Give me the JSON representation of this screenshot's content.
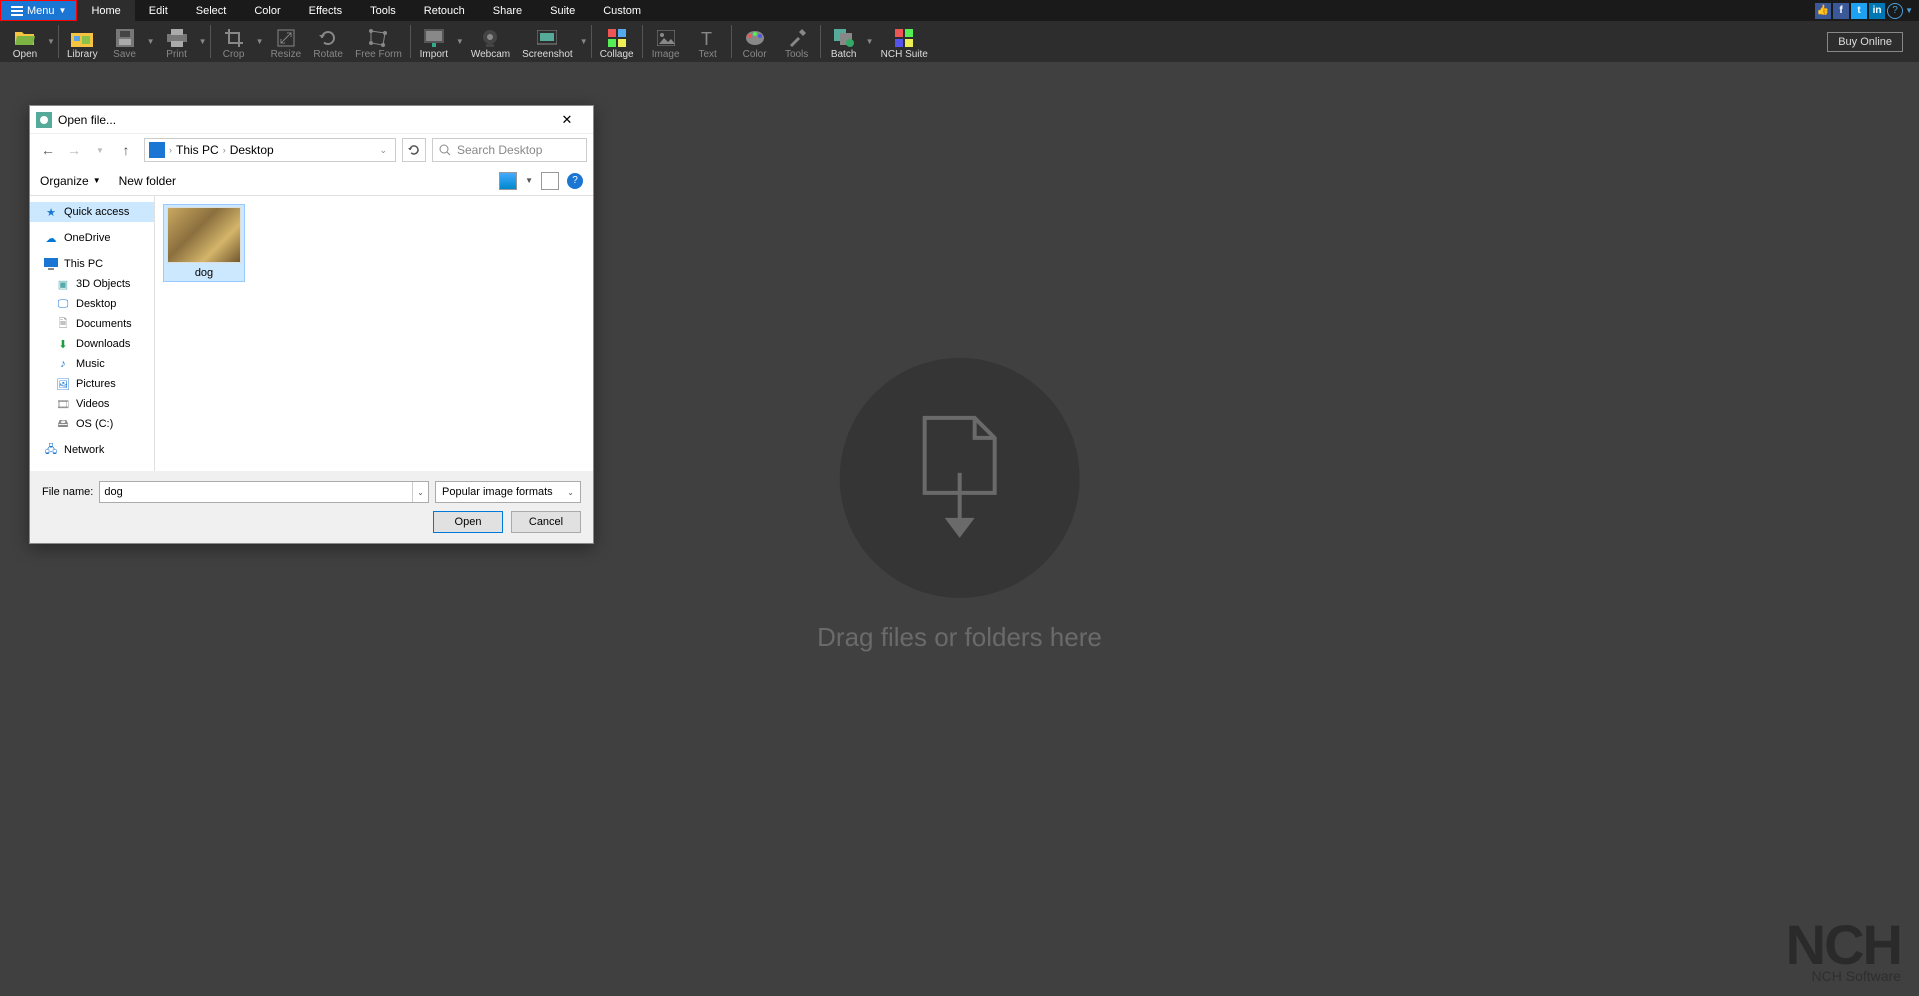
{
  "menu": {
    "button": "Menu",
    "tabs": [
      "Home",
      "Edit",
      "Select",
      "Color",
      "Effects",
      "Tools",
      "Retouch",
      "Share",
      "Suite",
      "Custom"
    ],
    "active": "Home"
  },
  "ribbon": {
    "open": "Open",
    "library": "Library",
    "save": "Save",
    "print": "Print",
    "crop": "Crop",
    "resize": "Resize",
    "rotate": "Rotate",
    "freeform": "Free Form",
    "import": "Import",
    "webcam": "Webcam",
    "screenshot": "Screenshot",
    "collage": "Collage",
    "image": "Image",
    "text": "Text",
    "color": "Color",
    "tools": "Tools",
    "batch": "Batch",
    "nchsuite": "NCH Suite",
    "buy": "Buy Online"
  },
  "canvas": {
    "drop_text": "Drag files or folders here"
  },
  "watermark": {
    "brand": "NCH",
    "sub": "NCH Software"
  },
  "dialog": {
    "title": "Open file...",
    "breadcrumb": {
      "root": "This PC",
      "folder": "Desktop"
    },
    "search_placeholder": "Search Desktop",
    "organize": "Organize",
    "newfolder": "New folder",
    "sidebar": {
      "quick": "Quick access",
      "onedrive": "OneDrive",
      "thispc": "This PC",
      "obj3d": "3D Objects",
      "desktop": "Desktop",
      "documents": "Documents",
      "downloads": "Downloads",
      "music": "Music",
      "pictures": "Pictures",
      "videos": "Videos",
      "osc": "OS (C:)",
      "network": "Network"
    },
    "file": {
      "name": "dog"
    },
    "footer": {
      "filename_label": "File name:",
      "filename_value": "dog",
      "filter": "Popular image formats",
      "open": "Open",
      "cancel": "Cancel"
    }
  }
}
